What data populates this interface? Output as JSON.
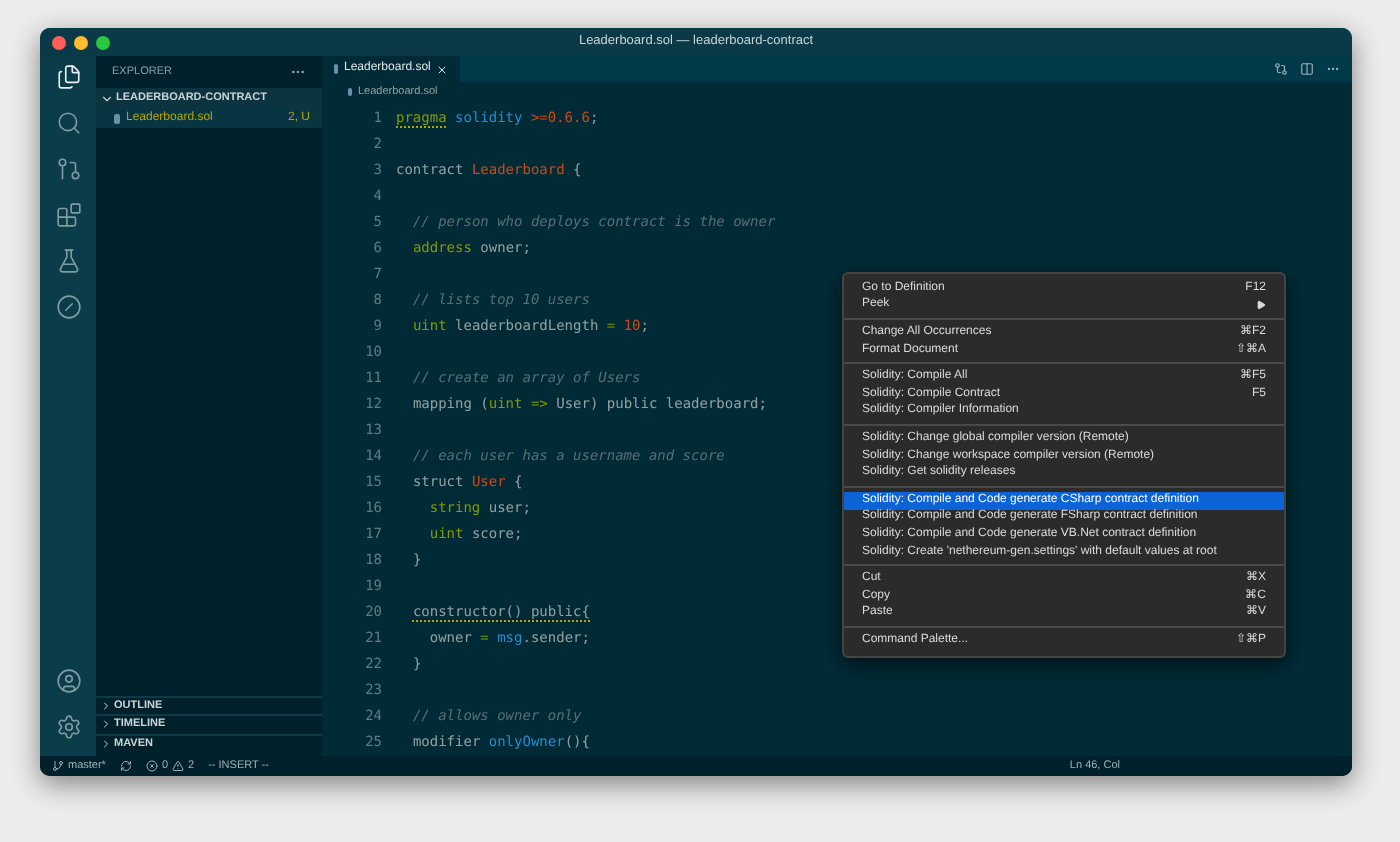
{
  "window": {
    "title": "Leaderboard.sol — leaderboard-contract"
  },
  "activity_bar": {
    "top": [
      {
        "kind": "files",
        "selected": true
      },
      {
        "kind": "search",
        "selected": false
      },
      {
        "kind": "source",
        "selected": false
      },
      {
        "kind": "extensions",
        "selected": false
      },
      {
        "kind": "testing",
        "selected": false
      },
      {
        "kind": "debug",
        "selected": false
      }
    ],
    "bottom": [
      {
        "kind": "account"
      },
      {
        "kind": "settings"
      }
    ]
  },
  "sidebar": {
    "title": "EXPLORER",
    "folder": {
      "label": "LEADERBOARD-CONTRACT",
      "expanded": true
    },
    "files": [
      {
        "name": "Leaderboard.sol",
        "badge": "2, U",
        "selected": true
      }
    ],
    "sections": [
      {
        "label": "OUTLINE",
        "expanded": false
      },
      {
        "label": "TIMELINE",
        "expanded": false
      },
      {
        "label": "MAVEN",
        "expanded": false
      }
    ]
  },
  "tabs": [
    {
      "label": "Leaderboard.sol",
      "selected": true
    }
  ],
  "breadcrumb": "Leaderboard.sol",
  "code": [
    {
      "number": "1",
      "tokens": [
        {
          "text": "pragma",
          "kind": "keyword",
          "underlined": true
        },
        {
          "text": " solidity",
          "kind": "builtin",
          "underlined": false
        },
        {
          "text": " >=0.6.6",
          "kind": "literal",
          "underlined": false
        },
        {
          "text": ";",
          "kind": "plain",
          "underlined": false
        }
      ]
    },
    {
      "number": "2"
    },
    {
      "number": "3",
      "tokens": [
        {
          "text": "contract ",
          "kind": "plain",
          "underlined": false
        },
        {
          "text": "Leaderboard",
          "kind": "name",
          "underlined": false
        },
        {
          "text": " {",
          "kind": "plain",
          "underlined": false
        }
      ]
    },
    {
      "number": "4"
    },
    {
      "number": "5",
      "tokens": [
        {
          "text": "  // person who deploys contract is the owner",
          "kind": "comment",
          "underlined": false
        }
      ]
    },
    {
      "number": "6",
      "tokens": [
        {
          "text": "  address",
          "kind": "keyword",
          "underlined": false
        },
        {
          "text": " owner;",
          "kind": "plain",
          "underlined": false
        }
      ]
    },
    {
      "number": "7"
    },
    {
      "number": "8",
      "tokens": [
        {
          "text": "  // lists top 10 users",
          "kind": "comment",
          "underlined": false
        }
      ]
    },
    {
      "number": "9",
      "tokens": [
        {
          "text": "  uint",
          "kind": "keyword",
          "underlined": false
        },
        {
          "text": " leaderboardLength ",
          "kind": "plain",
          "underlined": false
        },
        {
          "text": "=",
          "kind": "keyword",
          "underlined": false
        },
        {
          "text": " 10",
          "kind": "literal",
          "underlined": false
        },
        {
          "text": ";",
          "kind": "plain",
          "underlined": false
        }
      ]
    },
    {
      "number": "10"
    },
    {
      "number": "11",
      "tokens": [
        {
          "text": "  // create an array of Users",
          "kind": "comment",
          "underlined": false
        }
      ]
    },
    {
      "number": "12",
      "tokens": [
        {
          "text": "  mapping (",
          "kind": "plain",
          "underlined": false
        },
        {
          "text": "uint",
          "kind": "keyword",
          "underlined": false
        },
        {
          "text": " =>",
          "kind": "keyword",
          "underlined": false
        },
        {
          "text": " User) public leaderboard;",
          "kind": "plain",
          "underlined": false
        }
      ]
    },
    {
      "number": "13"
    },
    {
      "number": "14",
      "tokens": [
        {
          "text": "  // each user has a username and score",
          "kind": "comment",
          "underlined": false
        }
      ]
    },
    {
      "number": "15",
      "tokens": [
        {
          "text": "  struct ",
          "kind": "plain",
          "underlined": false
        },
        {
          "text": "User",
          "kind": "name",
          "underlined": false
        },
        {
          "text": " {",
          "kind": "plain",
          "underlined": false
        }
      ]
    },
    {
      "number": "16",
      "tokens": [
        {
          "text": "    string",
          "kind": "keyword",
          "underlined": false
        },
        {
          "text": " user;",
          "kind": "plain",
          "underlined": false
        }
      ]
    },
    {
      "number": "17",
      "tokens": [
        {
          "text": "    uint",
          "kind": "keyword",
          "underlined": false
        },
        {
          "text": " score;",
          "kind": "plain",
          "underlined": false
        }
      ]
    },
    {
      "number": "18",
      "tokens": [
        {
          "text": "  }",
          "kind": "plain",
          "underlined": false
        }
      ]
    },
    {
      "number": "19"
    },
    {
      "number": "20",
      "tokens": [
        {
          "text": "  constructor() public{",
          "kind": "plain",
          "underlined": true
        }
      ]
    },
    {
      "number": "21",
      "tokens": [
        {
          "text": "    owner ",
          "kind": "plain",
          "underlined": false
        },
        {
          "text": "=",
          "kind": "keyword",
          "underlined": false
        },
        {
          "text": " msg",
          "kind": "builtin",
          "underlined": false
        },
        {
          "text": ".sender;",
          "kind": "plain",
          "underlined": false
        }
      ]
    },
    {
      "number": "22",
      "tokens": [
        {
          "text": "  }",
          "kind": "plain",
          "underlined": false
        }
      ]
    },
    {
      "number": "23"
    },
    {
      "number": "24",
      "tokens": [
        {
          "text": "  // allows owner only",
          "kind": "comment",
          "underlined": false
        }
      ]
    },
    {
      "number": "25",
      "tokens": [
        {
          "text": "  modifier ",
          "kind": "plain",
          "underlined": false
        },
        {
          "text": "onlyOwner",
          "kind": "builtin",
          "underlined": false
        },
        {
          "text": "(){",
          "kind": "plain",
          "underlined": false
        }
      ]
    }
  ],
  "context_menu": {
    "groups": [
      {
        "items": [
          {
            "label": "Go to Definition",
            "shortcut": "F12",
            "selected": false,
            "submenu": false
          },
          {
            "label": "Peek",
            "selected": false,
            "submenu": true
          }
        ]
      },
      {
        "items": [
          {
            "label": "Change All Occurrences",
            "shortcut": "⌘F2",
            "selected": false,
            "submenu": false
          },
          {
            "label": "Format Document",
            "shortcut": "⇧⌘A",
            "selected": false,
            "submenu": false
          }
        ]
      },
      {
        "items": [
          {
            "label": "Solidity: Compile All",
            "shortcut": "⌘F5",
            "selected": false,
            "submenu": false
          },
          {
            "label": "Solidity: Compile Contract",
            "shortcut": "F5",
            "selected": false,
            "submenu": false
          },
          {
            "label": "Solidity: Compiler Information",
            "selected": false,
            "submenu": false
          }
        ]
      },
      {
        "items": [
          {
            "label": "Solidity: Change global compiler version (Remote)",
            "selected": false,
            "submenu": false
          },
          {
            "label": "Solidity: Change workspace compiler version (Remote)",
            "selected": false,
            "submenu": false
          },
          {
            "label": "Solidity: Get solidity releases",
            "selected": false,
            "submenu": false
          }
        ]
      },
      {
        "items": [
          {
            "label": "Solidity: Compile and Code generate CSharp contract definition",
            "selected": true,
            "submenu": false
          },
          {
            "label": "Solidity: Compile and Code generate FSharp contract definition",
            "selected": false,
            "submenu": false
          },
          {
            "label": "Solidity: Compile and Code generate VB.Net contract definition",
            "selected": false,
            "submenu": false
          },
          {
            "label": "Solidity: Create 'nethereum-gen.settings' with default values at root",
            "selected": false,
            "submenu": false
          }
        ]
      },
      {
        "items": [
          {
            "label": "Cut",
            "shortcut": "⌘X",
            "selected": false,
            "submenu": false
          },
          {
            "label": "Copy",
            "shortcut": "⌘C",
            "selected": false,
            "submenu": false
          },
          {
            "label": "Paste",
            "shortcut": "⌘V",
            "selected": false,
            "submenu": false
          }
        ]
      },
      {
        "items": [
          {
            "label": "Command Palette...",
            "shortcut": "⇧⌘P",
            "selected": false,
            "submenu": false
          }
        ]
      }
    ]
  },
  "status_bar": {
    "branch": "master*",
    "errors": "0",
    "warnings": "2",
    "mode": "-- INSERT --",
    "position": "Ln 46, Col"
  }
}
